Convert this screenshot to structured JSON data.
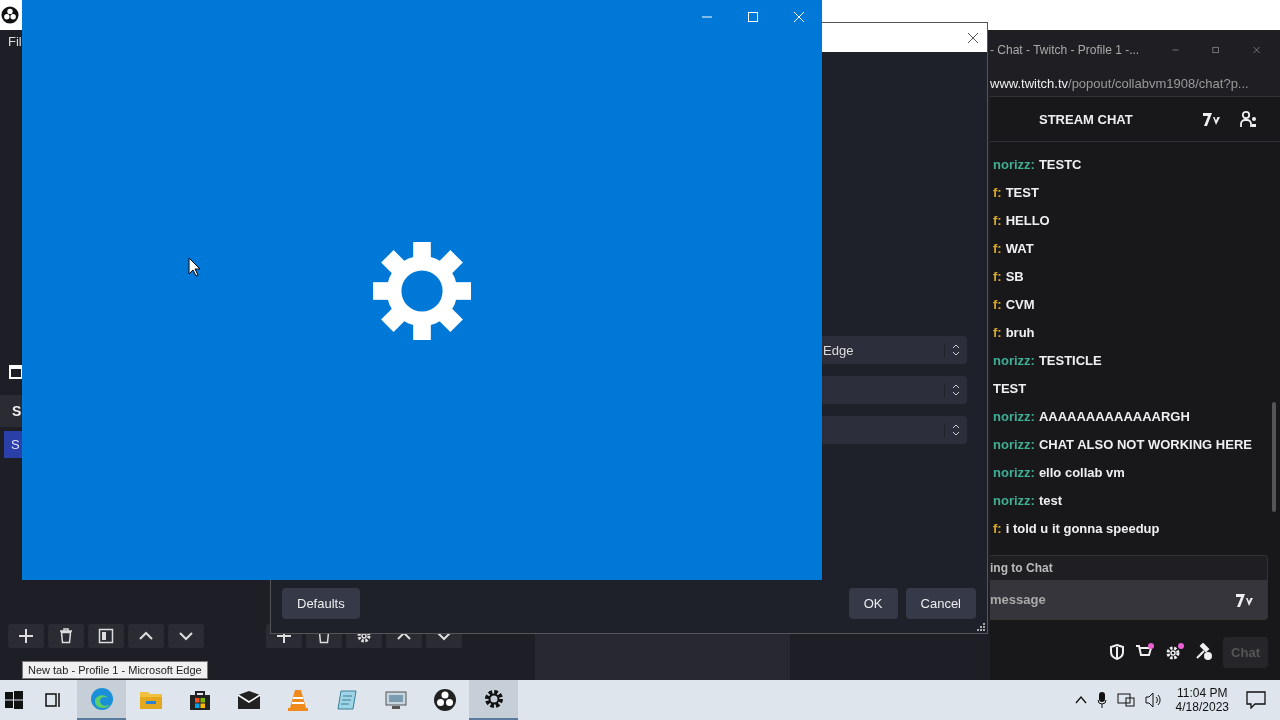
{
  "obs_window": {
    "menu": [
      "Fil"
    ],
    "scenes_header": "S",
    "scenes": [
      {
        "label": "S",
        "selected": true
      }
    ]
  },
  "settings_dialog": {
    "dropdowns": [
      {
        "kind": "filled",
        "value": "Edge"
      },
      {
        "kind": "blank"
      },
      {
        "kind": "blank"
      }
    ],
    "defaults_button": "Defaults",
    "ok_button": "OK",
    "cancel_button": "Cancel"
  },
  "chat_window": {
    "title": "- Chat - Twitch - Profile 1 -...",
    "url_host": "www.twitch.tv",
    "url_path": "/popout/collabvm1908/chat?p...",
    "header": "STREAM CHAT",
    "messages": [
      {
        "user": "norizz:",
        "text": "TESTC",
        "color": "#3fae95"
      },
      {
        "user": "f:",
        "text": "TEST",
        "color": "#d8a72a"
      },
      {
        "user": "f:",
        "text": "HELLO",
        "color": "#d8a72a"
      },
      {
        "user": "f:",
        "text": "WAT",
        "color": "#d8a72a"
      },
      {
        "user": "f:",
        "text": "SB",
        "color": "#d8a72a"
      },
      {
        "user": "f:",
        "text": "CVM",
        "color": "#d8a72a"
      },
      {
        "user": "f:",
        "text": "bruh",
        "color": "#d8a72a"
      },
      {
        "user": "norizz:",
        "text": "TESTICLE",
        "color": "#3fae95"
      },
      {
        "text": "TEST",
        "color": "#efeff1"
      },
      {
        "user": "norizz:",
        "text": "AAAAAAAAAAAAARGH",
        "color": "#3fae95"
      },
      {
        "user": "norizz:",
        "text": "CHAT ALSO NOT WORKING HERE",
        "color": "#3fae95"
      },
      {
        "user": "norizz:",
        "text": "ello collab vm",
        "color": "#3fae95"
      },
      {
        "user": "norizz:",
        "text": "test",
        "color": "#3fae95"
      },
      {
        "user": "f:",
        "text": "i told u it gonna speedup",
        "color": "#d8a72a"
      }
    ],
    "status": "ing to Chat",
    "placeholder": "message",
    "chat_button": "Chat"
  },
  "tooltip": "New tab - Profile 1 - Microsoft Edge",
  "taskbar": {
    "apps": [
      {
        "kind": "taskview",
        "selected": false
      },
      {
        "kind": "edge",
        "selected": true
      },
      {
        "kind": "folder",
        "selected": false
      },
      {
        "kind": "store",
        "selected": false
      },
      {
        "kind": "mail",
        "selected": false
      },
      {
        "kind": "cone",
        "selected": false
      },
      {
        "kind": "notes",
        "selected": false
      },
      {
        "kind": "remote",
        "selected": false
      },
      {
        "kind": "obs",
        "selected": false
      },
      {
        "kind": "settings",
        "selected": true
      }
    ],
    "time": "11:04 PM",
    "date": "4/18/2023"
  }
}
